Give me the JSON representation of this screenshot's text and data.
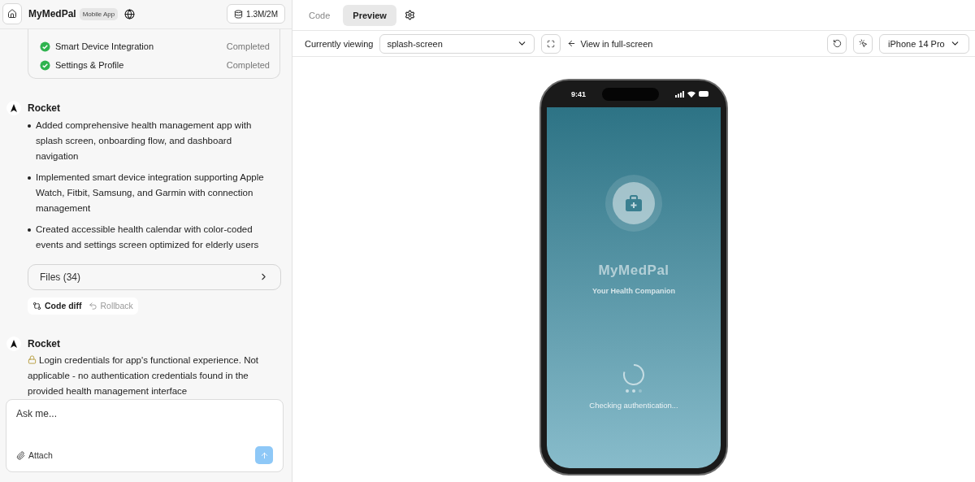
{
  "header": {
    "project": "MyMedPal",
    "badge": "Mobile App",
    "usage": "1.3M/2M"
  },
  "tasks": [
    {
      "name": "Smart Device Integration",
      "status": "Completed",
      "done": true
    },
    {
      "name": "Settings & Profile",
      "status": "Completed",
      "done": true
    }
  ],
  "messages": [
    {
      "author": "Rocket",
      "kind": "bullets",
      "bullets": [
        "Added comprehensive health management app with splash screen, onboarding flow, and dashboard navigation",
        "Implemented smart device integration supporting Apple Watch, Fitbit, Samsung, and Garmin with connection management",
        "Created accessible health calendar with color-coded events and settings screen optimized for elderly users"
      ],
      "files": "Files (34)",
      "actions": [
        {
          "label": "Code diff",
          "disabled": false
        },
        {
          "label": "Rollback",
          "disabled": true
        }
      ]
    },
    {
      "author": "Rocket",
      "kind": "paragraph",
      "text": "Login credentials for app's functional experience. Not applicable - no authentication credentials found in the provided health management interface"
    }
  ],
  "composer": {
    "placeholder": "Ask me...",
    "attach": "Attach"
  },
  "tabs": [
    {
      "label": "Code",
      "selected": false
    },
    {
      "label": "Preview",
      "selected": true
    }
  ],
  "toolbar": {
    "label": "Currently viewing",
    "screen": "splash-screen",
    "fullscreen": "View in full-screen",
    "device": "iPhone 14 Pro"
  },
  "phone": {
    "time": "9:41",
    "app_name": "MyMedPal",
    "tagline": "Your Health Companion",
    "status": "Checking authentication..."
  }
}
